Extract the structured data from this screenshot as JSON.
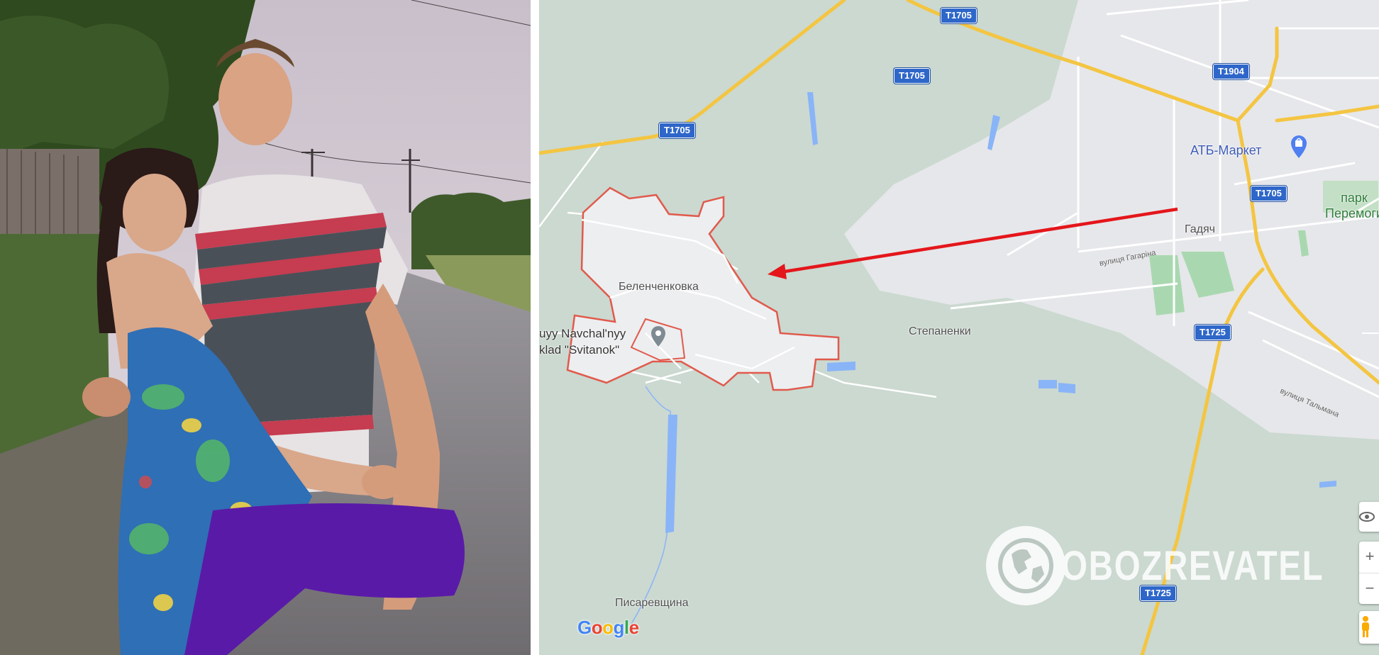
{
  "photo": {
    "subject": "couple-photo",
    "sky_color": "#d9d0d9",
    "tree_color": "#2f4a1f",
    "road_color": "#85828a"
  },
  "map": {
    "background_color": "#cad9d2",
    "highlight_outline_color": "#e24b3c",
    "arrow_color": "#e4161b",
    "road_color": "#f2c94c",
    "route_badges": {
      "t1705_a": "T1705",
      "t1705_b": "T1705",
      "t1705_c": "T1705",
      "t1705_d": "T1705",
      "t1904": "T1904",
      "t1725_a": "T1725",
      "t1725_b": "T1725"
    },
    "labels": {
      "village": "Беленченковка",
      "stepanenki": "Степаненки",
      "pysarevshchyna": "Писаревщина",
      "hadiach": "Гадяч",
      "atb": "АТБ-Маркет",
      "park": "парк\nПеремоги",
      "svitanok_line1": "uyy Navchal'nyy",
      "svitanok_line2": "klad \"Svitanok\"",
      "street_gagarina": "вулиця Гагаріна",
      "street_talmana": "вулиця Тальмана"
    },
    "google_logo": {
      "letters": [
        "G",
        "o",
        "o",
        "g",
        "l",
        "e"
      ],
      "colors": [
        "#4285f4",
        "#ea4335",
        "#fbbc05",
        "#4285f4",
        "#34a853",
        "#ea4335"
      ]
    },
    "icons": {
      "atb_pin": "shopping-bag-pin-icon",
      "svitanok_pin": "place-pin-icon",
      "street_view": "eye-icon",
      "zoom_in": "plus-icon",
      "zoom_out": "minus-icon",
      "pegman": "pegman-icon"
    },
    "controls": {
      "zoom_in": "+",
      "zoom_out": "−"
    }
  },
  "watermark": {
    "text": "OBOZREVATEL",
    "icon": "globe-icon"
  }
}
